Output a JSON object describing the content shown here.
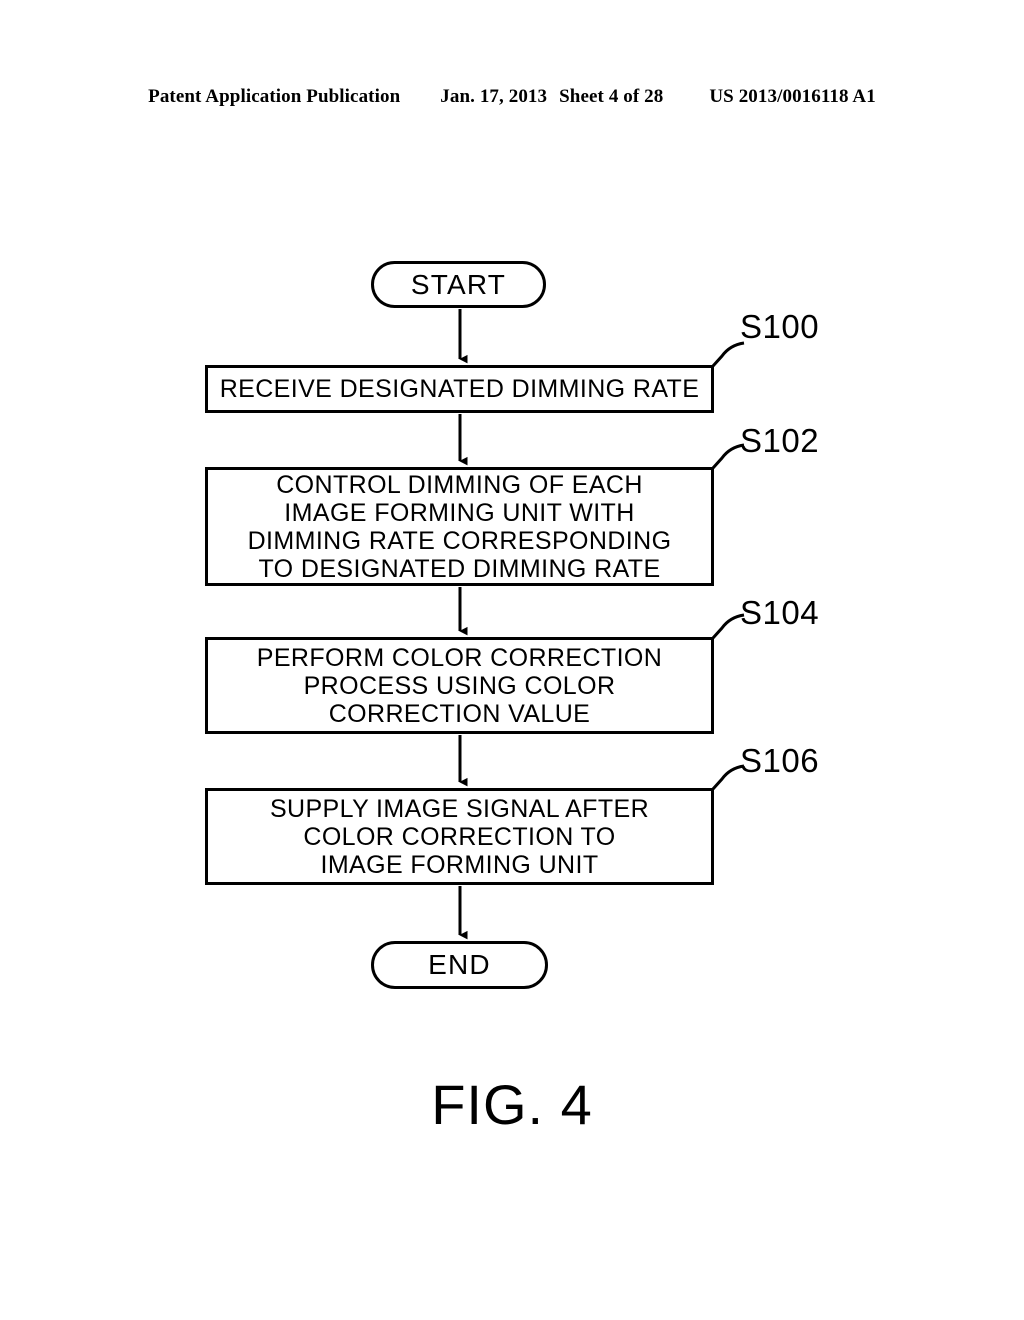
{
  "page": {
    "background_color": "#ffffff",
    "ink_color": "#000000"
  },
  "header": {
    "publication": "Patent Application Publication",
    "date": "Jan. 17, 2013",
    "sheet": "Sheet 4 of 28",
    "patent_number": "US 2013/0016118 A1"
  },
  "figure": {
    "caption": "FIG. 4",
    "type": "flowchart",
    "start_terminal": "START",
    "end_terminal": "END",
    "steps": [
      {
        "ref": "S100",
        "text": "RECEIVE DESIGNATED DIMMING RATE",
        "lines": [
          "RECEIVE DESIGNATED DIMMING RATE"
        ]
      },
      {
        "ref": "S102",
        "text": "CONTROL DIMMING OF EACH IMAGE FORMING UNIT WITH DIMMING RATE CORRESPONDING TO DESIGNATED DIMMING RATE",
        "lines": [
          "CONTROL DIMMING OF EACH",
          "IMAGE FORMING UNIT WITH",
          "DIMMING RATE CORRESPONDING",
          "TO DESIGNATED DIMMING RATE"
        ]
      },
      {
        "ref": "S104",
        "text": "PERFORM COLOR CORRECTION PROCESS USING COLOR CORRECTION VALUE",
        "lines": [
          "PERFORM COLOR CORRECTION",
          "PROCESS USING COLOR",
          "CORRECTION VALUE"
        ]
      },
      {
        "ref": "S106",
        "text": "SUPPLY IMAGE SIGNAL AFTER COLOR CORRECTION TO IMAGE FORMING UNIT",
        "lines": [
          "SUPPLY IMAGE SIGNAL AFTER",
          "COLOR CORRECTION TO",
          "IMAGE FORMING UNIT"
        ]
      }
    ]
  }
}
